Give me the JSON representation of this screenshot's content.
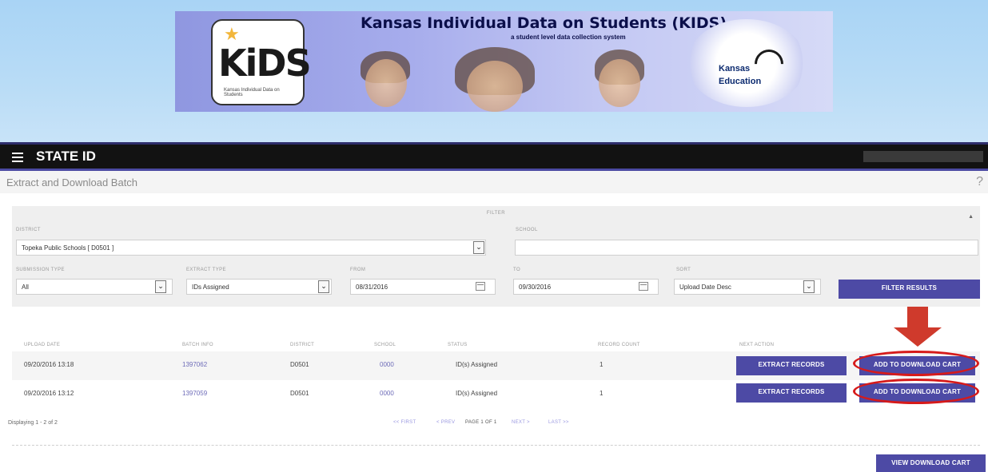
{
  "banner": {
    "title": "Kansas Individual Data on Students (KIDS)",
    "subtitle": "a student level data collection system",
    "kids_logo_text": "KiDS",
    "kids_logo_sub": "Kansas Individual Data on Students",
    "ksde_kansas": "Kansas",
    "ksde_education": "Education"
  },
  "nav": {
    "title": "STATE ID"
  },
  "page": {
    "title": "Extract and Download Batch",
    "help": "?"
  },
  "filter": {
    "title": "FILTER",
    "collapse": "▲",
    "district_label": "DISTRICT",
    "district_value": "Topeka Public Schools [ D0501 ]",
    "school_label": "SCHOOL",
    "school_value": "",
    "submission_type_label": "SUBMISSION TYPE",
    "submission_type_value": "All",
    "extract_type_label": "EXTRACT TYPE",
    "extract_type_value": "IDs Assigned",
    "from_label": "FROM",
    "from_value": "08/31/2016",
    "to_label": "TO",
    "to_value": "09/30/2016",
    "sort_label": "SORT",
    "sort_value": "Upload Date Desc",
    "filter_button": "FILTER RESULTS"
  },
  "table": {
    "headers": [
      "UPLOAD DATE",
      "BATCH INFO",
      "DISTRICT",
      "SCHOOL",
      "STATUS",
      "RECORD COUNT",
      "NEXT ACTION"
    ],
    "rows": [
      {
        "upload_date": "09/20/2016 13:18",
        "batch": "1397062",
        "district": "D0501",
        "school": "0000",
        "status": "ID(s) Assigned",
        "count": "1",
        "extract": "EXTRACT RECORDS",
        "add": "ADD TO DOWNLOAD CART"
      },
      {
        "upload_date": "09/20/2016 13:12",
        "batch": "1397059",
        "district": "D0501",
        "school": "0000",
        "status": "ID(s) Assigned",
        "count": "1",
        "extract": "EXTRACT RECORDS",
        "add": "ADD TO DOWNLOAD CART"
      }
    ]
  },
  "pagination": {
    "displaying": "Displaying 1 - 2 of 2",
    "first": "<< FIRST",
    "prev": "< PREV",
    "page": "PAGE 1 OF 1",
    "next": "NEXT >",
    "last": "LAST >>"
  },
  "cart": {
    "view_button": "VIEW DOWNLOAD CART"
  },
  "colors": {
    "accent": "#4d4aa5",
    "nav_bg": "#121212",
    "highlight": "#d61a1a",
    "banner_sky": "#b9dcf6"
  }
}
